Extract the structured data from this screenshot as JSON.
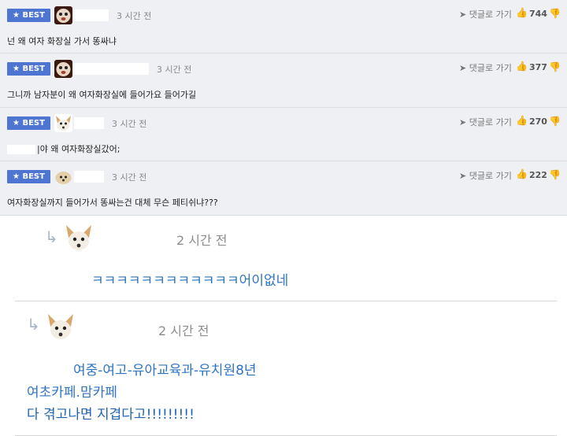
{
  "best_comments": [
    {
      "badge": "★ BEST",
      "time": "3 시간 전",
      "reply": "댓글로 가기",
      "likes": "744",
      "text": "넌 왜 여자 화장실 가서 똥싸냐"
    },
    {
      "badge": "★ BEST",
      "time": "3 시간 전",
      "reply": "댓글로 가기",
      "likes": "377",
      "text": "그니까 남자분이 왜 여자화장실에 들어가요 들어가길"
    },
    {
      "badge": "★ BEST",
      "time": "3 시간 전",
      "reply": "댓글로 가기",
      "likes": "270",
      "text": "|야 왜 여자화장실갔어;"
    },
    {
      "badge": "★ BEST",
      "time": "3 시간 전",
      "reply": "댓글로 가기",
      "likes": "222",
      "text": "여자화장실까지 들어가서 똥싸는건 대체 무슨 페티쉬냐???"
    }
  ],
  "replies": [
    {
      "time": "2 시간 전",
      "lines": [
        "ㅋㅋㅋㅋㅋㅋㅋㅋㅋㅋㅋㅋ어이없네"
      ]
    },
    {
      "time": "2 시간 전",
      "lines": [
        "여중-여고-유아교육과-유치원8년",
        "여초카페.맘카페",
        "다 겪고나면 지겹다고!!!!!!!!!"
      ]
    }
  ],
  "icons": {
    "badge_star": "star-icon",
    "reply_arrow": "reply-arrow-icon",
    "thumb_up": "thumbs-up-icon",
    "thumb_down": "thumbs-down-icon",
    "avatar": "dog-avatar-icon"
  },
  "colors": {
    "badge": "#4d75d1",
    "best_bg": "#eef0f4",
    "reply_text": "#2f75c3"
  }
}
